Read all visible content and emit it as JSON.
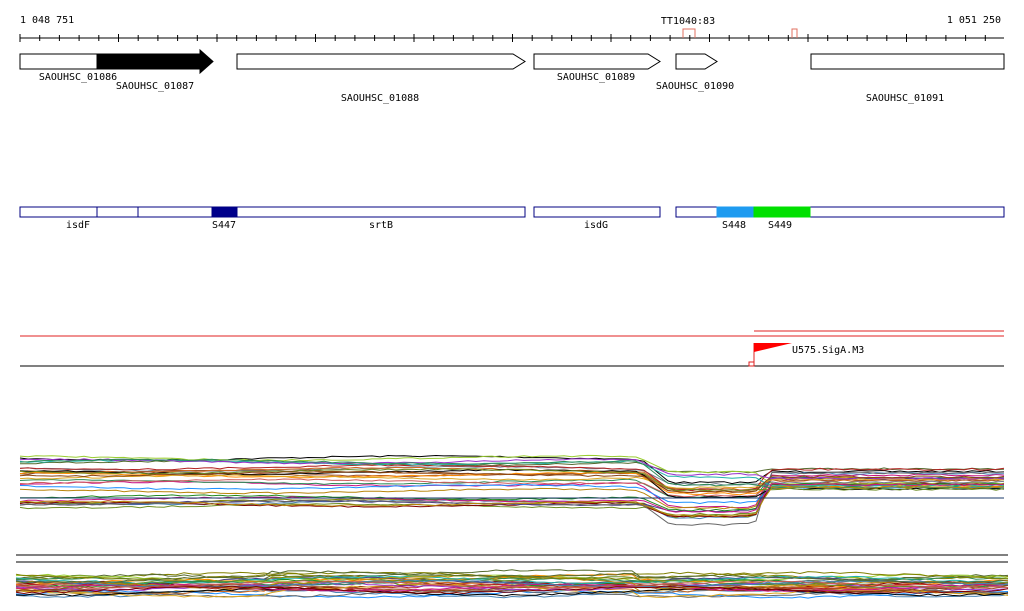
{
  "coordinates": {
    "start": "1 048 751",
    "end": "1 051 250",
    "start_value": 1048751,
    "end_value": 1051250
  },
  "terminator": {
    "label": "TT1040:83"
  },
  "genes": [
    {
      "label": "SAOUHSC_01086",
      "strand": "+",
      "filled": false
    },
    {
      "label": "SAOUHSC_01087",
      "strand": "+",
      "filled": true
    },
    {
      "label": "SAOUHSC_01088",
      "strand": "+",
      "filled": false
    },
    {
      "label": "SAOUHSC_01089",
      "strand": "+",
      "filled": false
    },
    {
      "label": "SAOUHSC_01090",
      "strand": "+",
      "filled": false
    },
    {
      "label": "SAOUHSC_01091",
      "strand": "+",
      "filled": false
    }
  ],
  "segments": [
    {
      "label": "isdF",
      "color": "#ffffff"
    },
    {
      "label": "",
      "color": "#ffffff"
    },
    {
      "label": "S447",
      "color": "#00008b"
    },
    {
      "label": "srtB",
      "color": "#ffffff"
    },
    {
      "label": "isdG",
      "color": "#ffffff"
    },
    {
      "label": "S448",
      "color": "#1e9bf0"
    },
    {
      "label": "S449",
      "color": "#00e000"
    }
  ],
  "promoter": {
    "label": "U575.SigA.M3",
    "color": "#ff0000"
  },
  "colors": {
    "gene_border": "#000000",
    "segment_border": "#000080",
    "terminator": "#e07060",
    "track_line": "#ff0000"
  }
}
